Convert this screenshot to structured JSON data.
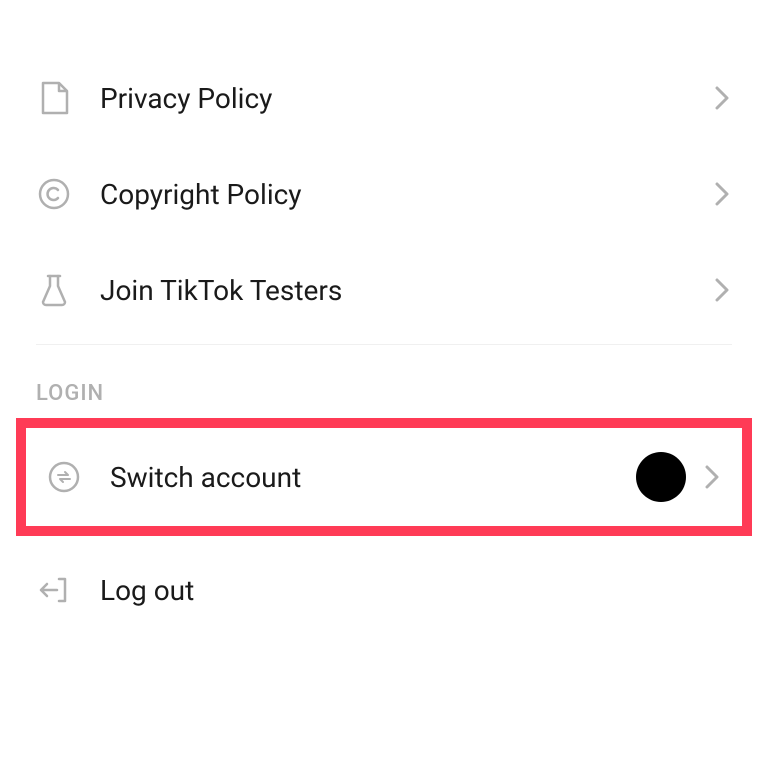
{
  "items": {
    "privacy": {
      "label": "Privacy Policy"
    },
    "copyright": {
      "label": "Copyright Policy"
    },
    "testers": {
      "label": "Join TikTok Testers"
    }
  },
  "login": {
    "section_label": "LOGIN",
    "switch_account": {
      "label": "Switch account"
    },
    "log_out": {
      "label": "Log out"
    }
  }
}
